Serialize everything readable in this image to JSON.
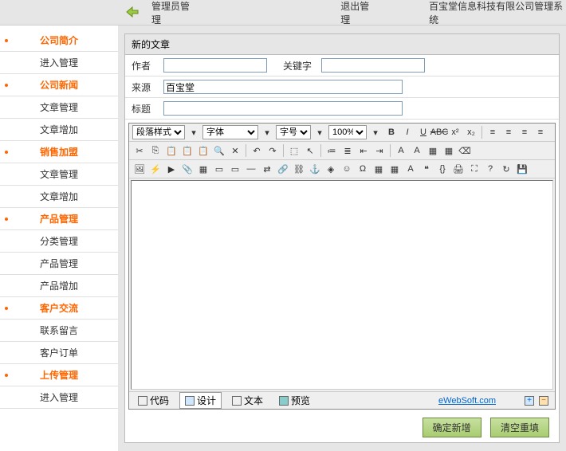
{
  "header": {
    "admin_manage": "管理员管理",
    "logout": "退出管理",
    "company": "百宝堂信息科技有限公司管理系统"
  },
  "sidebar": [
    {
      "label": "公司简介",
      "type": "cat"
    },
    {
      "label": "进入管理",
      "type": "sub"
    },
    {
      "label": "公司新闻",
      "type": "cat"
    },
    {
      "label": "文章管理",
      "type": "sub"
    },
    {
      "label": "文章增加",
      "type": "sub"
    },
    {
      "label": "销售加盟",
      "type": "cat"
    },
    {
      "label": "文章管理",
      "type": "sub"
    },
    {
      "label": "文章增加",
      "type": "sub"
    },
    {
      "label": "产品管理",
      "type": "cat"
    },
    {
      "label": "分类管理",
      "type": "sub"
    },
    {
      "label": "产品管理",
      "type": "sub"
    },
    {
      "label": "产品增加",
      "type": "sub"
    },
    {
      "label": "客户交流",
      "type": "cat"
    },
    {
      "label": "联系留言",
      "type": "sub"
    },
    {
      "label": "客户订单",
      "type": "sub"
    },
    {
      "label": "上传管理",
      "type": "cat"
    },
    {
      "label": "进入管理",
      "type": "sub"
    }
  ],
  "form": {
    "box_title": "新的文章",
    "author_label": "作者",
    "author_value": "",
    "keyword_label": "关键字",
    "keyword_value": "",
    "source_label": "来源",
    "source_value": "百宝堂",
    "title_label": "标题",
    "title_value": ""
  },
  "editor": {
    "para_style": "段落样式",
    "font_family": "字体",
    "font_size": "字号",
    "zoom": "100%",
    "modes": {
      "code": "代码",
      "design": "设计",
      "text": "文本",
      "preview": "预览"
    },
    "brand": "eWebSoft.com"
  },
  "buttons": {
    "confirm": "确定新增",
    "clear": "清空重填"
  }
}
